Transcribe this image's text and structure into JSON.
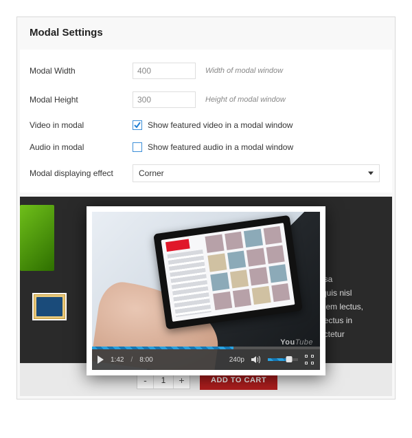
{
  "panel": {
    "title": "Modal Settings",
    "width": {
      "label": "Modal Width",
      "value": "400",
      "hint": "Width of modal window"
    },
    "height": {
      "label": "Modal Height",
      "value": "300",
      "hint": "Height of modal window"
    },
    "video": {
      "label": "Video in modal",
      "checked": true,
      "desc": "Show featured video in a modal window"
    },
    "audio": {
      "label": "Audio in modal",
      "checked": false,
      "desc": "Show featured audio in a modal window"
    },
    "effect": {
      "label": "Modal displaying effect",
      "selected": "Corner"
    }
  },
  "preview": {
    "blurb1": "assa",
    "blurb2": "n quis nisl",
    "blurb3": "s sem lectus,",
    "blurb4": "d lectus in",
    "blurb5": "sectetur",
    "quantity": "1",
    "add_to_cart": "ADD TO CART"
  },
  "player": {
    "elapsed": "1:42",
    "sep": "/",
    "total": "8:00",
    "quality": "240p",
    "logo_a": "You",
    "logo_b": "Tube"
  }
}
